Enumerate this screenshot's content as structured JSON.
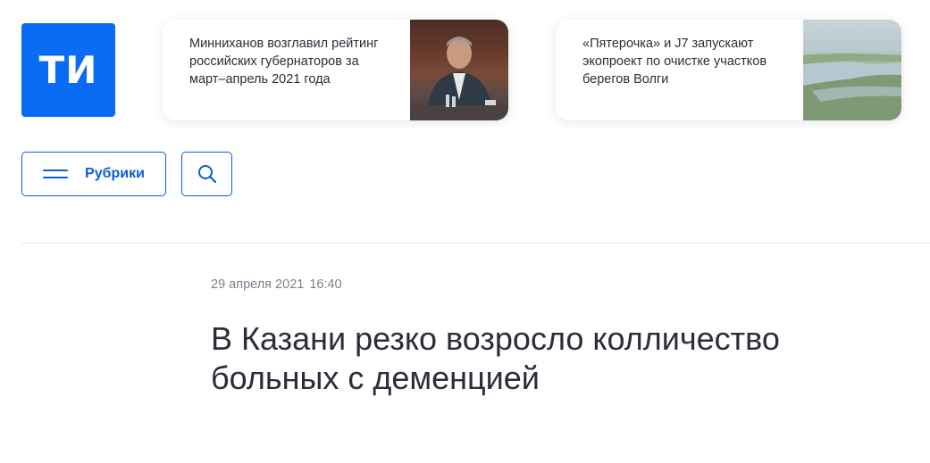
{
  "logo": {
    "text": "ТИ",
    "color": "#0a6cf5"
  },
  "top_news": [
    {
      "title": "Минниханов возглавил рейтинг российских губернаторов за март–апрель 2021 года",
      "image": "official-portrait-photo"
    },
    {
      "title": "«Пятерочка» и J7 запускают экопроект по очистке участков берегов Волги",
      "image": "volga-river-photo"
    }
  ],
  "nav": {
    "rubrics_label": "Рубрики",
    "rubrics_icon": "menu-icon",
    "search_icon": "search-icon",
    "accent": "#0a5fd6"
  },
  "article": {
    "date": "29 апреля 2021",
    "time": "16:40",
    "headline": "В Казани резко возросло колличество больных с деменцией"
  }
}
